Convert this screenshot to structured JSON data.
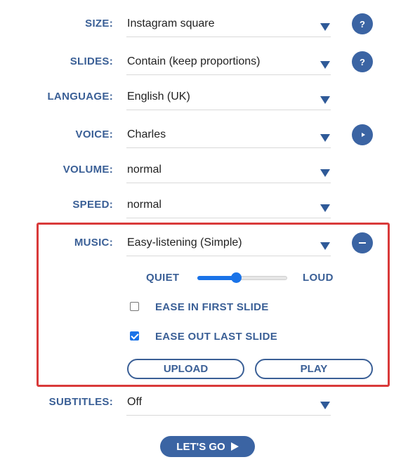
{
  "settings": {
    "size": {
      "label": "SIZE:",
      "value": "Instagram square"
    },
    "slides": {
      "label": "SLIDES:",
      "value": "Contain (keep proportions)"
    },
    "language": {
      "label": "LANGUAGE:",
      "value": "English (UK)"
    },
    "voice": {
      "label": "VOICE:",
      "value": "Charles"
    },
    "volume": {
      "label": "VOLUME:",
      "value": "normal"
    },
    "speed": {
      "label": "SPEED:",
      "value": "normal"
    },
    "music": {
      "label": "MUSIC:",
      "value": "Easy-listening (Simple)"
    },
    "subtitles": {
      "label": "SUBTITLES:",
      "value": "Off"
    }
  },
  "help_icon_text": "?",
  "music_panel": {
    "quiet_label": "QUIET",
    "loud_label": "LOUD",
    "volume_level": 0.43,
    "ease_in": {
      "label": "EASE IN FIRST SLIDE",
      "checked": false
    },
    "ease_out": {
      "label": "EASE OUT LAST SLIDE",
      "checked": true
    },
    "upload_label": "UPLOAD",
    "play_label": "PLAY"
  },
  "go_label": "LET'S GO",
  "colors": {
    "accent": "#3b64a3",
    "label": "#3a5f96",
    "highlight_border": "#d93a3a",
    "slider": "#1a73e8"
  },
  "icons": [
    "help-icon",
    "play-icon",
    "minus-icon",
    "dropdown-arrow-icon",
    "play-triangle-icon"
  ]
}
